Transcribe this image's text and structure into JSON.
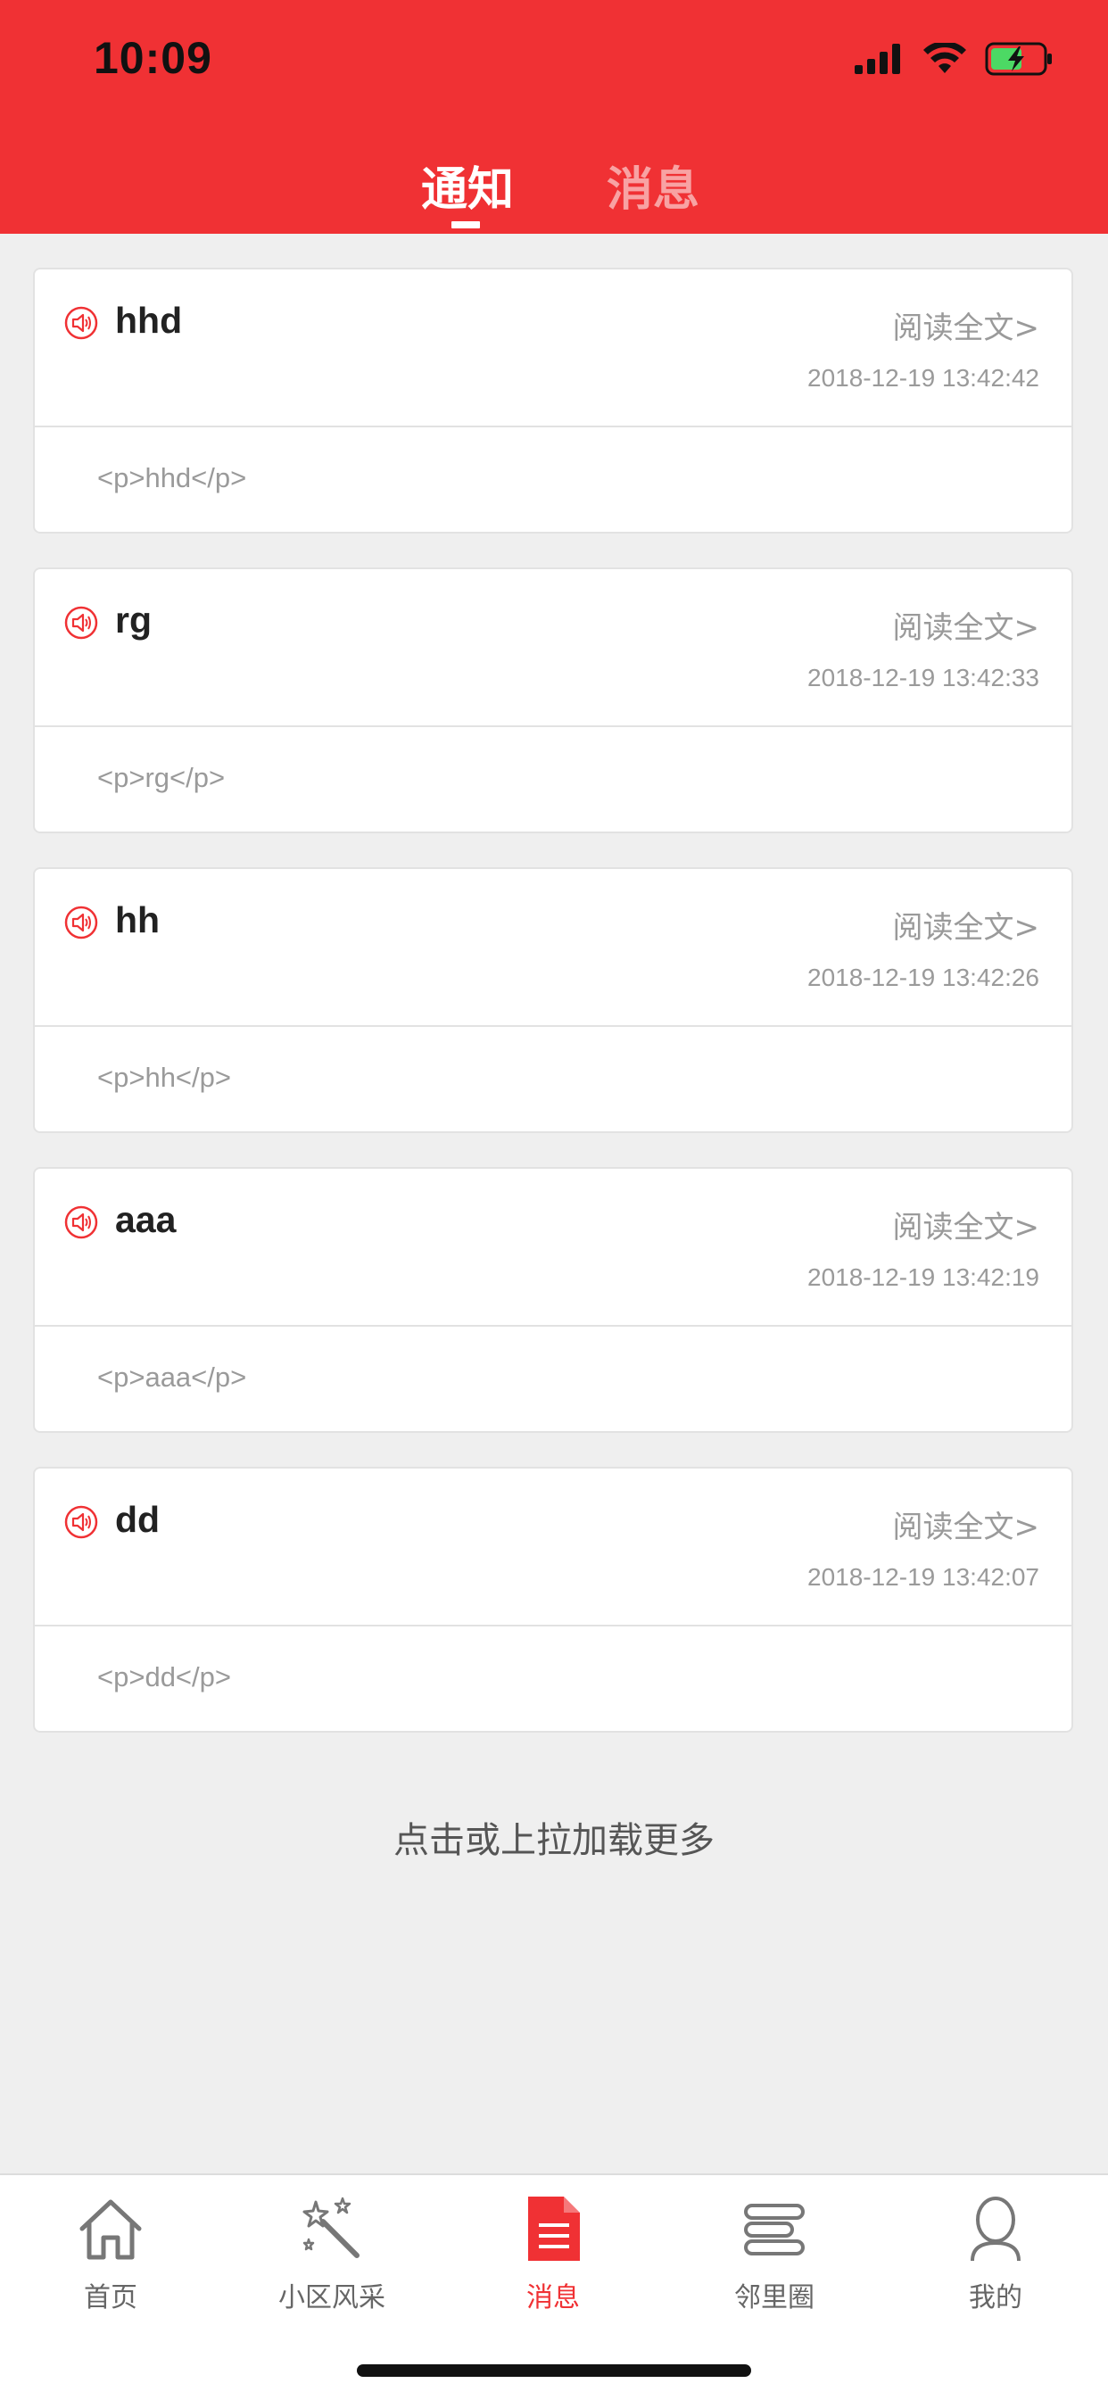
{
  "status_bar": {
    "time": "10:09"
  },
  "tabs": {
    "notice": "通知",
    "message": "消息",
    "active": "notice"
  },
  "colors": {
    "accent": "#f03134",
    "battery": "#4cd964"
  },
  "cards": [
    {
      "title": "hhd",
      "read_more": "阅读全文>",
      "time": "2018-12-19 13:42:42",
      "body": "<p>hhd</p>"
    },
    {
      "title": "rg",
      "read_more": "阅读全文>",
      "time": "2018-12-19 13:42:33",
      "body": "<p>rg</p>"
    },
    {
      "title": "hh",
      "read_more": "阅读全文>",
      "time": "2018-12-19 13:42:26",
      "body": "<p>hh</p>"
    },
    {
      "title": "aaa",
      "read_more": "阅读全文>",
      "time": "2018-12-19 13:42:19",
      "body": "<p>aaa</p>"
    },
    {
      "title": "dd",
      "read_more": "阅读全文>",
      "time": "2018-12-19 13:42:07",
      "body": "<p>dd</p>"
    }
  ],
  "load_more": "点击或上拉加载更多",
  "tabbar": {
    "items": [
      {
        "label": "首页",
        "icon": "home-icon"
      },
      {
        "label": "小区风采",
        "icon": "magic-wand-icon"
      },
      {
        "label": "消息",
        "icon": "document-icon",
        "active": true
      },
      {
        "label": "邻里圈",
        "icon": "list-icon"
      },
      {
        "label": "我的",
        "icon": "user-icon"
      }
    ]
  }
}
